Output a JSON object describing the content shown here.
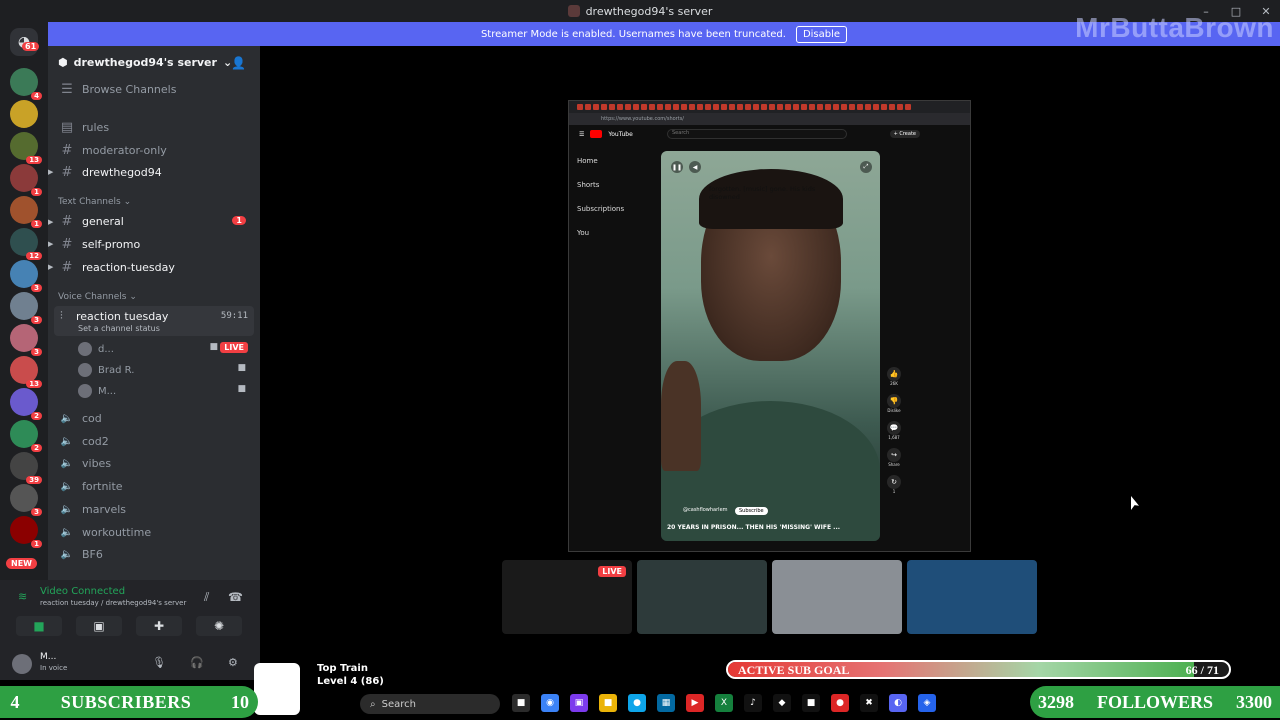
{
  "window": {
    "title": "drewthegod94's server",
    "controls": [
      "–",
      "□",
      "✕"
    ]
  },
  "banner": {
    "message": "Streamer Mode is enabled. Usernames have been truncated.",
    "disable_label": "Disable"
  },
  "watermark": "MrButtaBrown",
  "rail": {
    "home_badge": "61",
    "servers": [
      {
        "badge": "4",
        "color": "#3b7a57"
      },
      {
        "badge": "",
        "color": "#c9a227"
      },
      {
        "badge": "13",
        "color": "#556b2f"
      },
      {
        "badge": "1",
        "color": "#8b3a3a"
      },
      {
        "badge": "1",
        "color": "#a0522d"
      },
      {
        "badge": "12",
        "color": "#2f4f4f"
      },
      {
        "badge": "3",
        "color": "#4682b4"
      },
      {
        "badge": "3",
        "color": "#708090"
      },
      {
        "badge": "3",
        "color": "#b56576"
      },
      {
        "badge": "13",
        "color": "#c94c4c"
      },
      {
        "badge": "2",
        "color": "#6a5acd"
      },
      {
        "badge": "2",
        "color": "#2e8b57"
      },
      {
        "badge": "39",
        "color": "#444"
      },
      {
        "badge": "3",
        "color": "#555"
      },
      {
        "badge": "1",
        "color": "#8b0000"
      }
    ],
    "new_label": "NEW"
  },
  "sidebar": {
    "server_name": "drewthegod94's server",
    "browse_channels": "Browse Channels",
    "top_channels": [
      "rules",
      "moderator-only",
      "drewthegod94"
    ],
    "text_category": "Text Channels",
    "text_channels": [
      {
        "name": "general",
        "badge": "1"
      },
      {
        "name": "self-promo",
        "badge": ""
      },
      {
        "name": "reaction-tuesday",
        "badge": ""
      }
    ],
    "voice_category": "Voice Channels",
    "active_voice": {
      "name": "reaction tuesday",
      "status": "Set a channel status",
      "timer": "59:11"
    },
    "voice_users": [
      {
        "name": "d...",
        "live": "LIVE"
      },
      {
        "name": "Brad R.",
        "live": ""
      },
      {
        "name": "M...",
        "live": ""
      }
    ],
    "voice_channels": [
      "cod",
      "cod2",
      "vibes",
      "fortnite",
      "marvels",
      "workouttime",
      "BF6"
    ]
  },
  "panel": {
    "connected": "Video Connected",
    "location": "reaction tuesday / drewthegod94's server",
    "username": "M...",
    "user_status": "In voice"
  },
  "youtube": {
    "url": "https://www.youtube.com/shorts/",
    "brand": "YouTube",
    "search_placeholder": "Search",
    "create_label": "+ Create",
    "side_items": [
      "Home",
      "Shorts",
      "Subscriptions",
      "You"
    ],
    "caption": "forgotten. [music] gone. His kids disowned",
    "channel": "@cashflowharlem",
    "subscribe": "Subscribe",
    "short_title": "20 YEARS IN PRISON... THEN HIS 'MISSING' WIFE ...",
    "actions": [
      {
        "icon": "👍",
        "label": "26K"
      },
      {
        "icon": "👎",
        "label": "Dislike"
      },
      {
        "icon": "💬",
        "label": "1,687"
      },
      {
        "icon": "↪",
        "label": "Share"
      },
      {
        "icon": "↻",
        "label": "1"
      }
    ]
  },
  "tiles": [
    {
      "live": "LIVE",
      "color": "#1a1a1a"
    },
    {
      "live": "",
      "color": "#2d3a3a"
    },
    {
      "live": "",
      "color": "#8a8f95"
    },
    {
      "live": "",
      "color": "#1f4e79"
    }
  ],
  "overlay": {
    "top_train_title": "Top Train",
    "top_train_level": "Level 4 (86)",
    "sub_goal_label": "ACTIVE SUB GOAL",
    "sub_goal_count": "66 / 71",
    "sub_goal_fraction": 0.93,
    "subs_current": "4",
    "subs_label": "SUBSCRIBERS",
    "subs_target": "10",
    "followers_current": "3298",
    "followers_label": "FOLLOWERS",
    "followers_target": "3300"
  },
  "taskbar": {
    "search_placeholder": "Search",
    "apps": [
      {
        "glyph": "■",
        "color": "#2b2b2b"
      },
      {
        "glyph": "◉",
        "color": "#3b82f6"
      },
      {
        "glyph": "▣",
        "color": "#7c3aed"
      },
      {
        "glyph": "■",
        "color": "#eab308"
      },
      {
        "glyph": "●",
        "color": "#0ea5e9"
      },
      {
        "glyph": "▦",
        "color": "#0369a1"
      },
      {
        "glyph": "▶",
        "color": "#dc2626"
      },
      {
        "glyph": "X",
        "color": "#15803d"
      },
      {
        "glyph": "♪",
        "color": "#111"
      },
      {
        "glyph": "◆",
        "color": "#111"
      },
      {
        "glyph": "■",
        "color": "#111"
      },
      {
        "glyph": "●",
        "color": "#dc2626"
      },
      {
        "glyph": "✖",
        "color": "#111"
      },
      {
        "glyph": "◐",
        "color": "#5865f2"
      },
      {
        "glyph": "◈",
        "color": "#2563eb"
      }
    ]
  }
}
